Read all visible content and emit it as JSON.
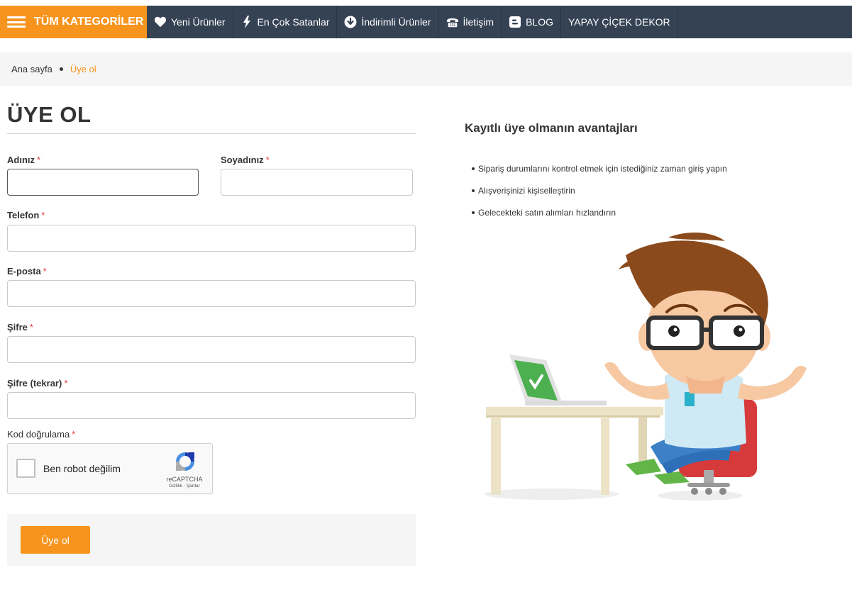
{
  "navbar": {
    "categories_label": "TÜM KATEGORİLER",
    "items": [
      {
        "label": "Yeni Ürünler",
        "icon": "heart-icon"
      },
      {
        "label": "En Çok Satanlar",
        "icon": "lightning-icon"
      },
      {
        "label": "İndirimli Ürünler",
        "icon": "down-circle-icon"
      },
      {
        "label": "İletişim",
        "icon": "phone-icon"
      },
      {
        "label": "BLOG",
        "icon": "blogger-icon"
      },
      {
        "label": "YAPAY ÇİÇEK DEKOR",
        "icon": ""
      }
    ]
  },
  "breadcrumb": {
    "home": "Ana sayfa",
    "current": "Üye ol"
  },
  "form": {
    "title": "ÜYE OL",
    "required_mark": "*",
    "fields": {
      "first_name": {
        "label": "Adınız",
        "value": ""
      },
      "last_name": {
        "label": "Soyadınız",
        "value": ""
      },
      "phone": {
        "label": "Telefon",
        "value": ""
      },
      "email": {
        "label": "E-posta",
        "value": ""
      },
      "password": {
        "label": "Şifre",
        "value": ""
      },
      "password_repeat": {
        "label": "Şifre (tekrar)",
        "value": ""
      }
    },
    "captcha": {
      "label": "Kod doğrulama",
      "checkbox_text": "Ben robot değilim",
      "brand": "reCAPTCHA",
      "links": "Gizlilik - Şartlar"
    },
    "submit_label": "Üye ol"
  },
  "advantages": {
    "title": "Kayıtlı üye olmanın avantajları",
    "items": [
      "Sipariş durumlarını kontrol etmek için istediğiniz zaman giriş yapın",
      "Alışverişinizi kişiselleştirin",
      "Gelecekteki satın alımları hızlandırın"
    ]
  },
  "colors": {
    "accent": "#f7941d",
    "navbar": "#354254",
    "required": "#e63c3c"
  }
}
